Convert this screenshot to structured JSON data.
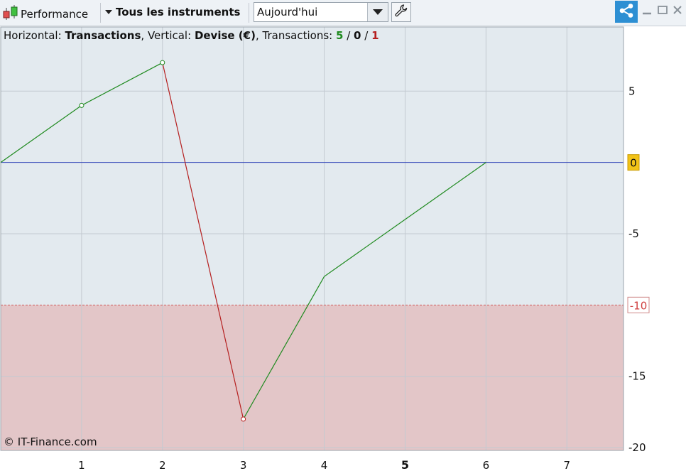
{
  "toolbar": {
    "strategy_label": "Performance",
    "instruments_label": "Tous les instruments",
    "period_value": "Aujourd'hui",
    "icons": {
      "strategy": "candlestick-icon",
      "instruments_dropdown": "triangle-down-icon",
      "period_dropdown": "triangle-down-icon",
      "settings": "wrench-icon",
      "share": "share-icon",
      "minimize": "minimize-icon",
      "maximize": "maximize-icon",
      "close": "close-icon"
    },
    "share_color": "#2d8fd3"
  },
  "header": {
    "horizontal_label": "Horizontal:",
    "horizontal_value": "Transactions",
    "vertical_label": "Vertical:",
    "vertical_value": "Devise (€)",
    "transactions_label": "Transactions:",
    "wins": "5",
    "breakeven": "0",
    "losses": "1",
    "separator": "/",
    "comma": ","
  },
  "copyright": "© IT-Finance.com",
  "chart_data": {
    "type": "line",
    "x": [
      0,
      1,
      2,
      3,
      4,
      5,
      6
    ],
    "y": [
      0,
      4,
      7,
      -18,
      -8,
      -4,
      0
    ],
    "markers_at": [
      1,
      2,
      3
    ],
    "xlim": [
      0,
      7.7
    ],
    "ylim": [
      -20.2,
      9.5
    ],
    "x_ticks": [
      "1",
      "2",
      "3",
      "4",
      "5",
      "6",
      "7"
    ],
    "x_tick_values": [
      1,
      2,
      3,
      4,
      5,
      6,
      7
    ],
    "highlighted_x_tick": "5",
    "y_ticks": [
      "5",
      "0",
      "-5",
      "-10",
      "-15",
      "-20"
    ],
    "y_tick_values": [
      5,
      0,
      -5,
      -10,
      -15,
      -20
    ],
    "zero_label": "0",
    "zero_line_color": "#3044b8",
    "drawdown_threshold": -10,
    "drawdown_label": "-10",
    "gain_color": "#1f8a1f",
    "loss_color": "#b51f1f",
    "plot_background": "#e3eaef",
    "drawdown_background": "#e3c6c8",
    "grid": true
  }
}
